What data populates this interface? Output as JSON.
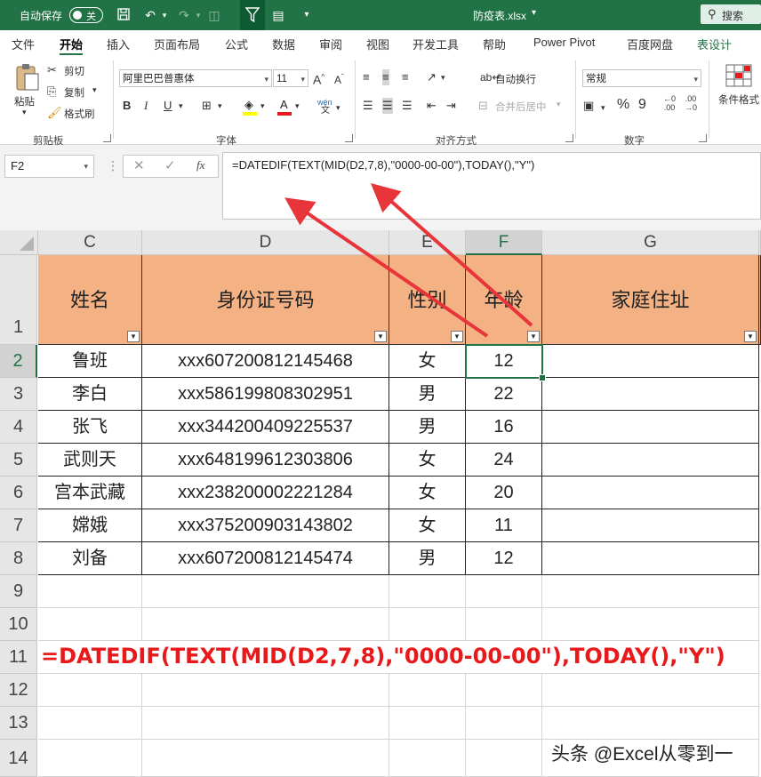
{
  "titlebar": {
    "autosave_label": "自动保存",
    "autosave_state": "关",
    "file_name": "防疫表.xlsx",
    "file_dropdown": "▾",
    "search_label": "搜索"
  },
  "tabs": [
    "文件",
    "开始",
    "插入",
    "页面布局",
    "公式",
    "数据",
    "审阅",
    "视图",
    "开发工具",
    "帮助",
    "Power Pivot",
    "百度网盘",
    "表设计"
  ],
  "ribbon": {
    "paste": "粘贴",
    "cut": "剪切",
    "copy": "复制",
    "format_painter": "格式刷",
    "clipboard_group": "剪贴板",
    "font_name": "阿里巴巴普惠体",
    "font_size": "11",
    "font_group": "字体",
    "wrap_text": "自动换行",
    "merge_center": "合并后居中",
    "alignment_group": "对齐方式",
    "number_format": "常规",
    "number_group": "数字",
    "conditional_format": "条件格式",
    "bold": "B",
    "italic": "I",
    "underline": "U",
    "phonetic": "wén"
  },
  "formula_bar": {
    "name_box": "F2",
    "fx": "fx",
    "formula": "=DATEDIF(TEXT(MID(D2,7,8),\"0000-00-00\"),TODAY(),\"Y\")"
  },
  "columns": [
    "C",
    "D",
    "E",
    "F",
    "G"
  ],
  "rows": [
    "1",
    "2",
    "3",
    "4",
    "5",
    "6",
    "7",
    "8",
    "9",
    "10",
    "11",
    "12",
    "13",
    "14"
  ],
  "table": {
    "headers": [
      "姓名",
      "身份证号码",
      "性别",
      "年龄",
      "家庭住址"
    ],
    "rows": [
      [
        "鲁班",
        "xxx607200812145468",
        "女",
        "12",
        ""
      ],
      [
        "李白",
        "xxx586199808302951",
        "男",
        "22",
        ""
      ],
      [
        "张飞",
        "xxx344200409225537",
        "男",
        "16",
        ""
      ],
      [
        "武则天",
        "xxx648199612303806",
        "女",
        "24",
        ""
      ],
      [
        "宫本武藏",
        "xxx238200002221284",
        "女",
        "20",
        ""
      ],
      [
        "嫦娥",
        "xxx375200903143802",
        "女",
        "11",
        ""
      ],
      [
        "刘备",
        "xxx607200812145474",
        "男",
        "12",
        ""
      ]
    ]
  },
  "cell_c11": "=DATEDIF(TEXT(MID(D2,7,8),\"0000-00-00\"),TODAY(),\"Y\")",
  "watermark": "头条 @Excel从零到一",
  "colors": {
    "excel_green": "#217346",
    "header_fill": "#f4b183",
    "annotation_red": "#e8191b"
  }
}
